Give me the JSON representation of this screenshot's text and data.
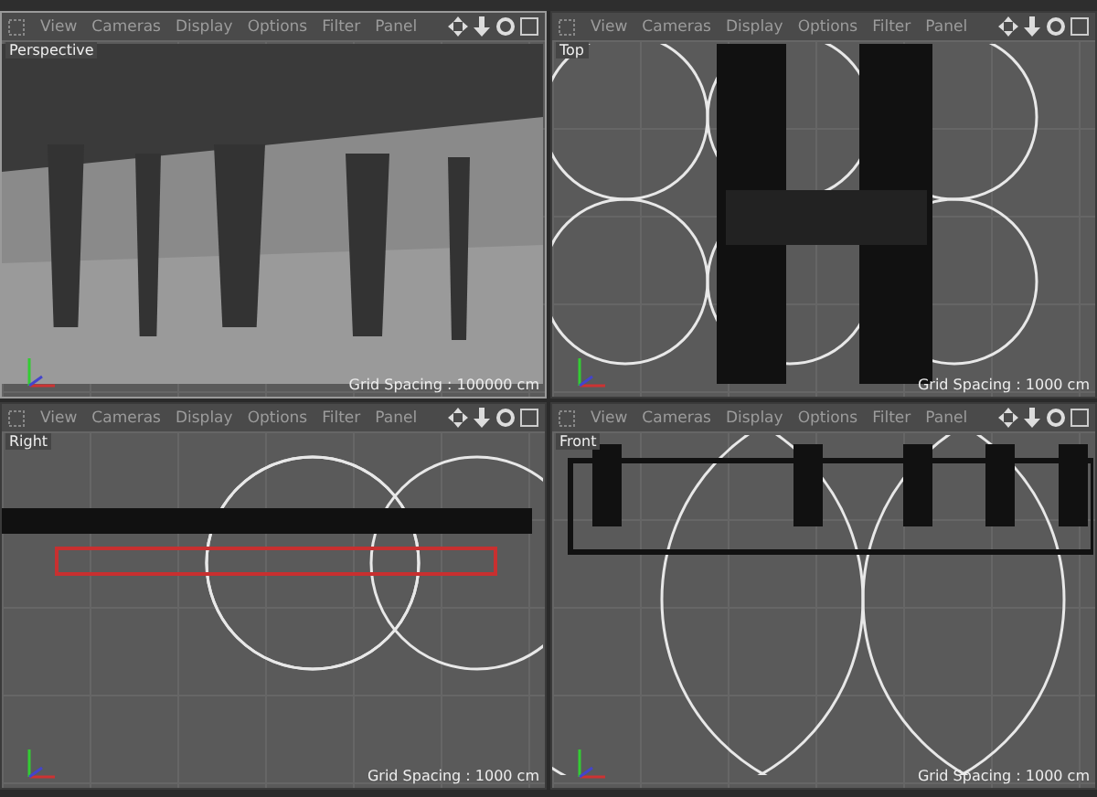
{
  "viewports": [
    {
      "label": "Perspective",
      "kind": "perspective",
      "selected": true,
      "menus": [
        "View",
        "Cameras",
        "Display",
        "Options",
        "Filter",
        "Panel"
      ],
      "grid_spacing": "Grid Spacing : 100000 cm"
    },
    {
      "label": "Top",
      "kind": "top",
      "selected": false,
      "menus": [
        "View",
        "Cameras",
        "Display",
        "Options",
        "Filter",
        "Panel"
      ],
      "grid_spacing": "Grid Spacing : 1000 cm"
    },
    {
      "label": "Right",
      "kind": "right",
      "selected": false,
      "menus": [
        "View",
        "Cameras",
        "Display",
        "Options",
        "Filter",
        "Panel"
      ],
      "grid_spacing": "Grid Spacing : 1000 cm"
    },
    {
      "label": "Front",
      "kind": "front",
      "selected": false,
      "menus": [
        "View",
        "Cameras",
        "Display",
        "Options",
        "Filter",
        "Panel"
      ],
      "grid_spacing": "Grid Spacing : 1000 cm"
    }
  ]
}
